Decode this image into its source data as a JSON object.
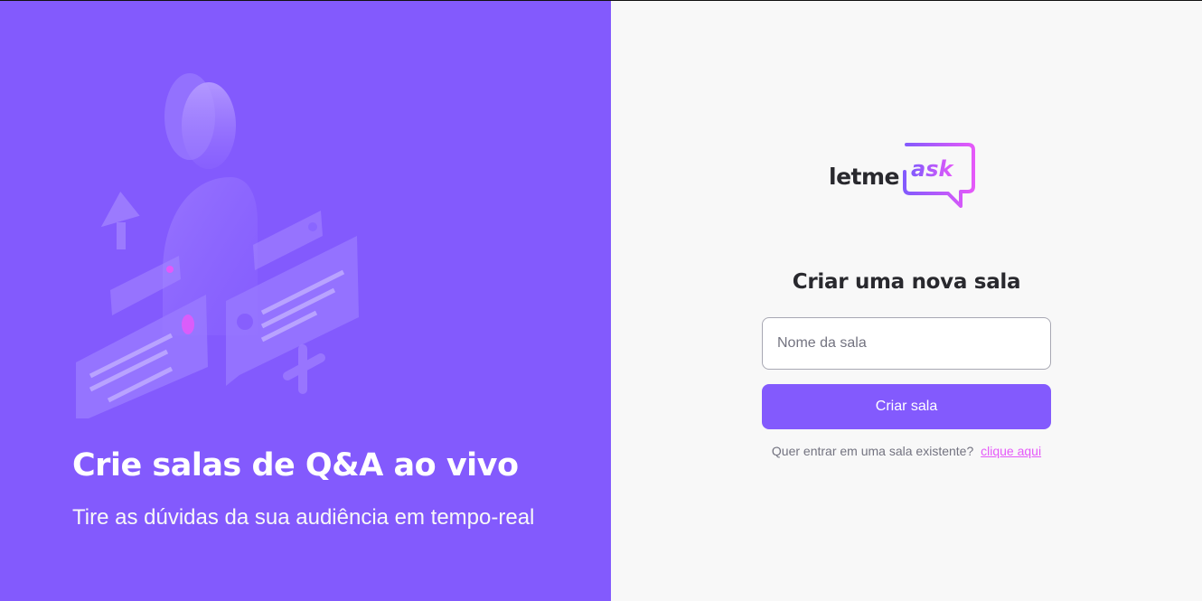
{
  "aside": {
    "title": "Crie salas de Q&A ao vivo",
    "subtitle": "Tire as dúvidas da sua audiência em tempo-real",
    "illustration_icon": "qa-illustration"
  },
  "logo": {
    "text": "letme",
    "accent_text": "ask"
  },
  "form": {
    "title": "Criar uma nova sala",
    "input_placeholder": "Nome da sala",
    "input_value": "",
    "submit_label": "Criar sala",
    "helper_text": "Quer entrar em uma sala existente?",
    "helper_link": "clique aqui"
  },
  "colors": {
    "brand": "#835afd",
    "accent": "#e559f9",
    "background": "#f8f8f8",
    "text": "#29292e",
    "muted": "#737380"
  }
}
